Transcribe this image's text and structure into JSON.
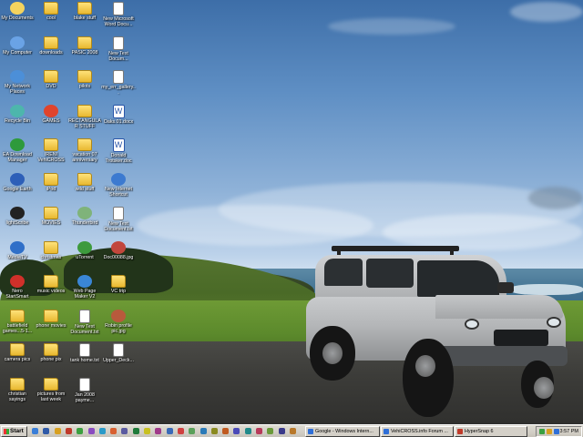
{
  "desktop": {
    "icons": [
      {
        "label": "My Documents",
        "type": "app",
        "color": "#f4d35e"
      },
      {
        "label": "My Computer",
        "type": "app",
        "color": "#6aa3e6"
      },
      {
        "label": "My Network Places",
        "type": "app",
        "color": "#4c8fd8"
      },
      {
        "label": "Recycle Bin",
        "type": "app",
        "color": "#4db6ac"
      },
      {
        "label": "EA Download Manager",
        "type": "app",
        "color": "#2e9a3c"
      },
      {
        "label": "Google Earth",
        "type": "app",
        "color": "#2d5fb8"
      },
      {
        "label": "lightScribe",
        "type": "app",
        "color": "#222222"
      },
      {
        "label": "MediaTV",
        "type": "app",
        "color": "#2f6fc8"
      },
      {
        "label": "Nero StartSmart",
        "type": "app",
        "color": "#d0302a"
      },
      {
        "label": "battlefield games...5-1...",
        "type": "folder"
      },
      {
        "label": "camera pics",
        "type": "folder"
      },
      {
        "label": "christian sayings",
        "type": "folder"
      },
      {
        "label": "cool",
        "type": "folder"
      },
      {
        "label": "downloads",
        "type": "folder"
      },
      {
        "label": "DVD",
        "type": "folder"
      },
      {
        "label": "GAMES",
        "type": "app",
        "color": "#e0442c"
      },
      {
        "label": "IRENI VehiCROSS",
        "type": "folder"
      },
      {
        "label": "iPod",
        "type": "folder"
      },
      {
        "label": "MOVIES",
        "type": "folder"
      },
      {
        "label": "christmas",
        "type": "folder"
      },
      {
        "label": "music videos",
        "type": "folder"
      },
      {
        "label": "phone movies",
        "type": "folder"
      },
      {
        "label": "phone pix",
        "type": "folder"
      },
      {
        "label": "pictures from last week",
        "type": "folder"
      },
      {
        "label": "blake stuff",
        "type": "folder"
      },
      {
        "label": "PASIC 2008",
        "type": "folder"
      },
      {
        "label": "pilots",
        "type": "folder"
      },
      {
        "label": "RECTANGULAR STUFF",
        "type": "folder"
      },
      {
        "label": "vacation 07 anniversary",
        "type": "folder"
      },
      {
        "label": "wild stuff",
        "type": "folder"
      },
      {
        "label": "Thunderbird",
        "type": "app",
        "color": "#7fb37a"
      },
      {
        "label": "uTorrent",
        "type": "app",
        "color": "#3d9a3d"
      },
      {
        "label": "Web Page Maker V2",
        "type": "app",
        "color": "#3a86d6"
      },
      {
        "label": "New Text Document.txt",
        "type": "doc"
      },
      {
        "label": "tank home.txt",
        "type": "doc"
      },
      {
        "label": "Jan 2008 payme...",
        "type": "doc"
      },
      {
        "label": "New Microsoft Word Docu...",
        "type": "doc"
      },
      {
        "label": "New Text Docum...",
        "type": "doc"
      },
      {
        "label": "my_err_gallery...",
        "type": "doc"
      },
      {
        "label": "Oaks.01.docx",
        "type": "word"
      },
      {
        "label": "Donald Trotsker.doc",
        "type": "word"
      },
      {
        "label": "New Internet Shortcut",
        "type": "app",
        "color": "#3c7ad0"
      },
      {
        "label": "New Text Document.txt",
        "type": "doc"
      },
      {
        "label": "Doc00088.jpg",
        "type": "app",
        "color": "#c2473c"
      },
      {
        "label": "VC trip",
        "type": "folder"
      },
      {
        "label": "Robin profile pic.jpg",
        "type": "app",
        "color": "#b85a3c"
      },
      {
        "label": "Upper_Deck...",
        "type": "doc"
      }
    ]
  },
  "taskbar": {
    "start_label": "Start",
    "quick_launch_colors": [
      "#3a7ed8",
      "#2f5aa8",
      "#d8a020",
      "#c03a2a",
      "#3ca040",
      "#8a4cc0",
      "#2a9ac8",
      "#d86030",
      "#5a5aa0",
      "#1f7a3a",
      "#c8c020",
      "#a03a8a",
      "#3a6ab8",
      "#d04040",
      "#5aa05a",
      "#2a7ab8",
      "#8a8a20",
      "#c05a20",
      "#4a4ab8",
      "#208a8a",
      "#b83a5a",
      "#6a9a3a",
      "#3a3a8a",
      "#b8782a"
    ],
    "tasks": [
      {
        "label": "Google - Windows Intern...",
        "color": "#2f6fd8"
      },
      {
        "label": "VehiCROSS.info Forum ...",
        "color": "#2f6fd8"
      },
      {
        "label": "HyperSnap 6",
        "color": "#c03a2a"
      }
    ],
    "tray": {
      "time": "3:57 PM",
      "icon_colors": [
        "#3aa040",
        "#d8a020",
        "#2f6fd8"
      ]
    }
  }
}
